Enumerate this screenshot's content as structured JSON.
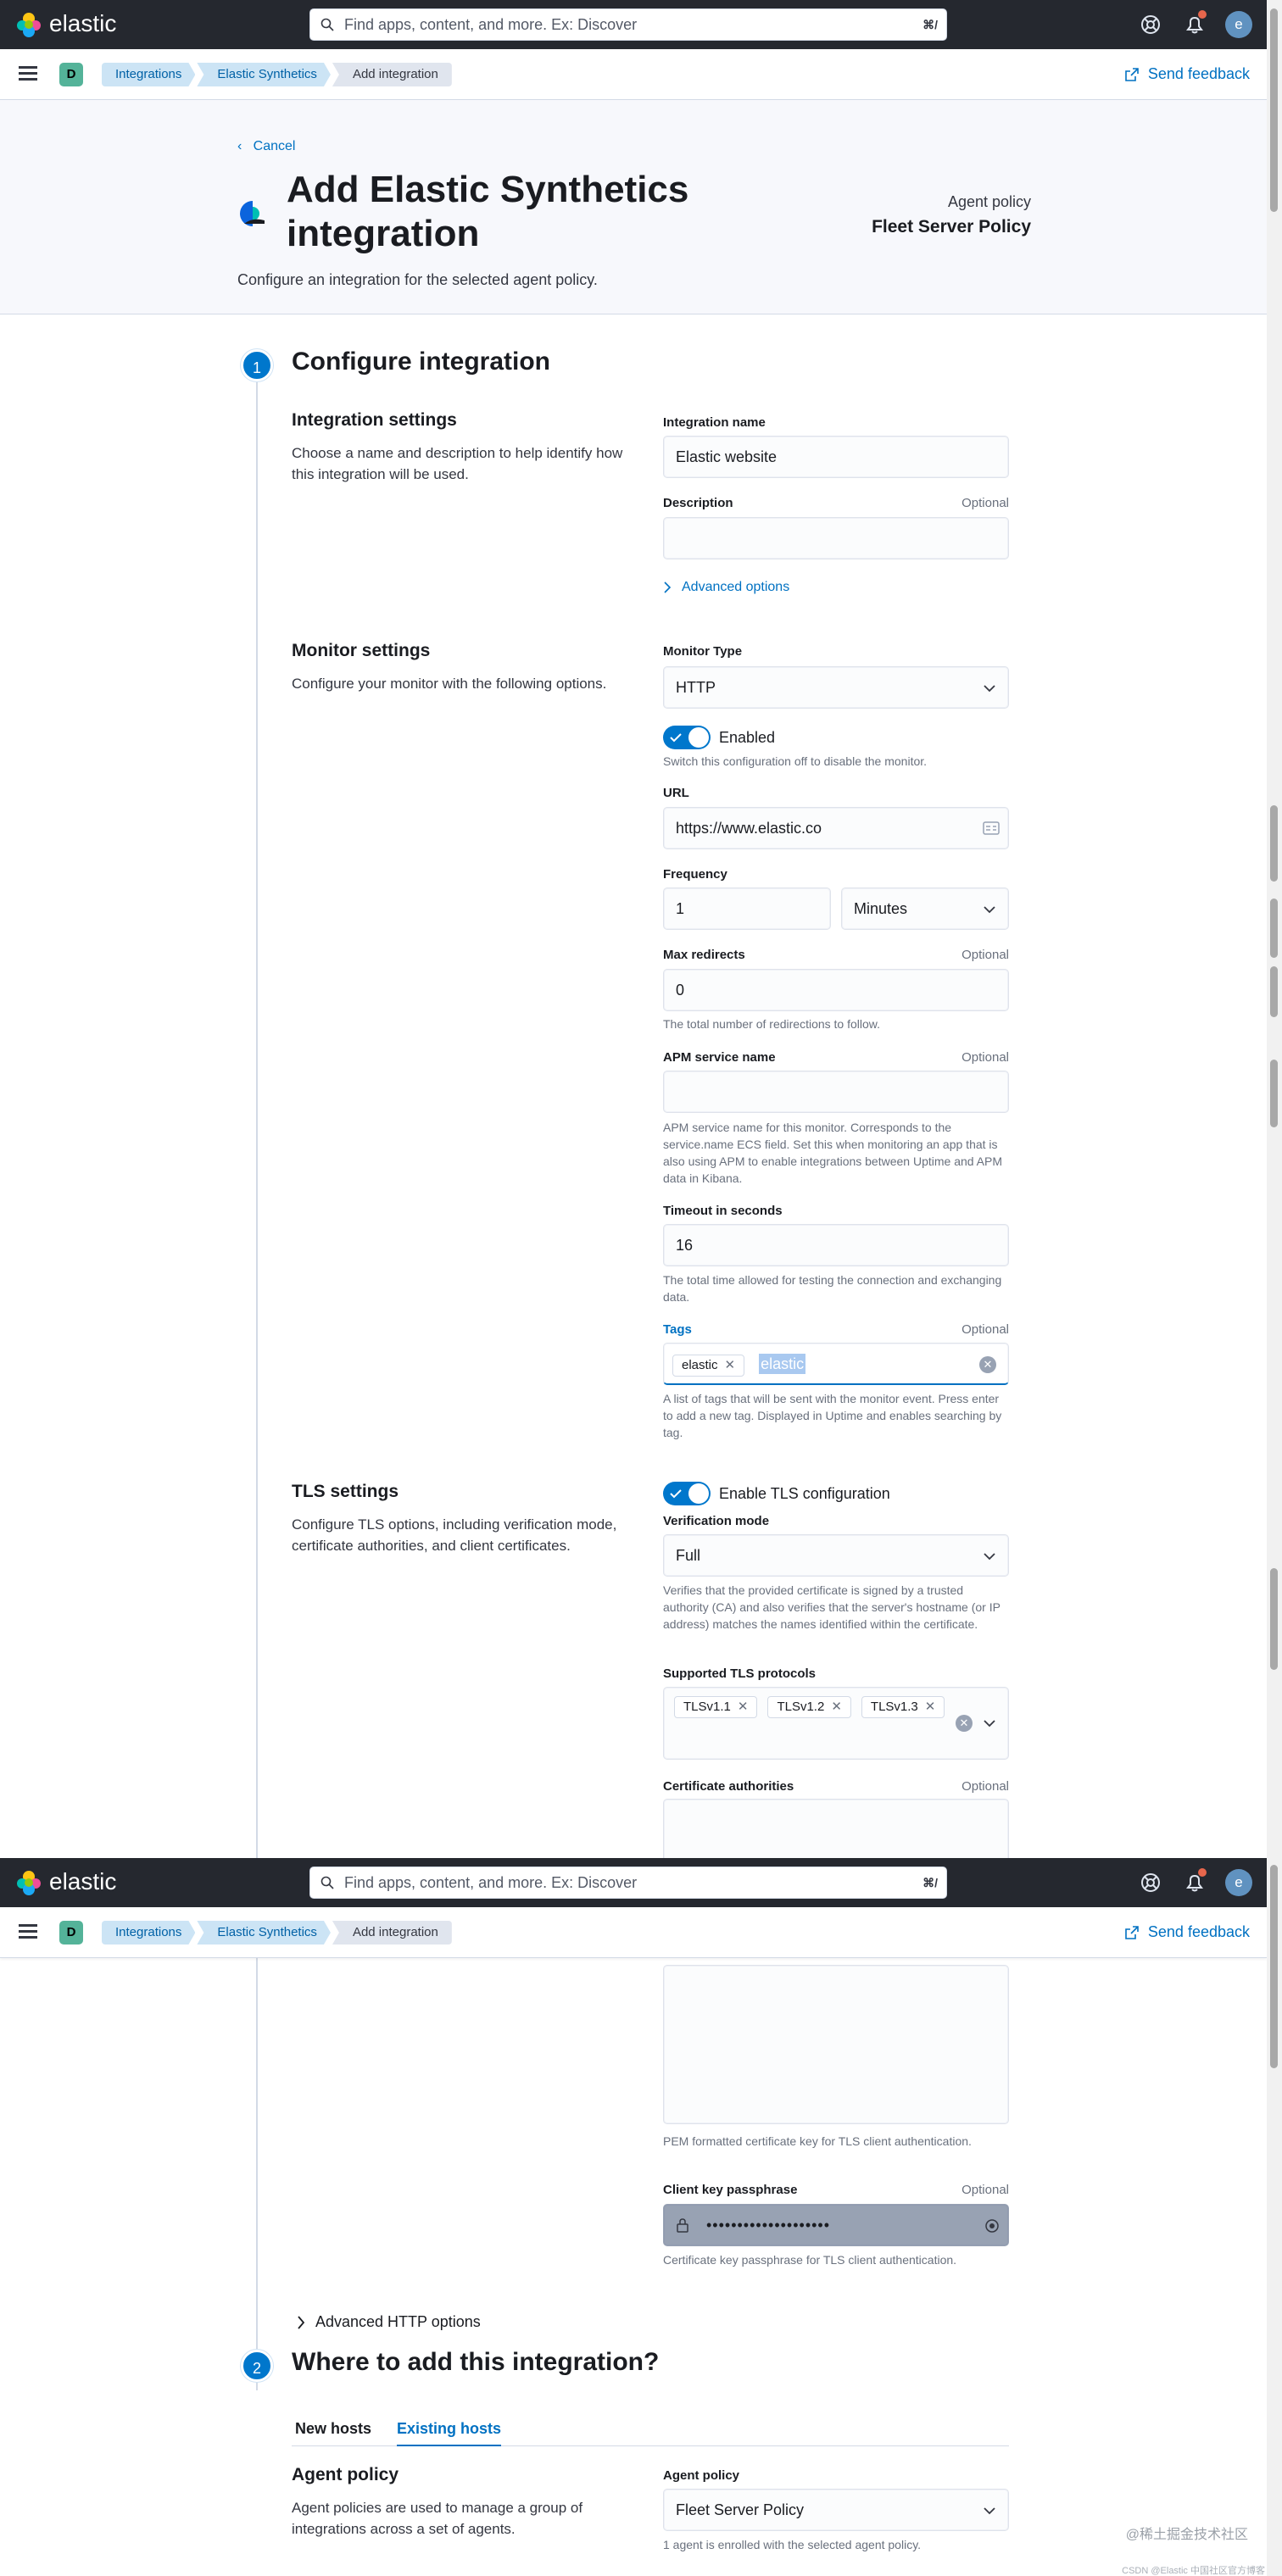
{
  "header": {
    "logo_text": "elastic",
    "search_placeholder": "Find apps, content, and more. Ex: Discover",
    "search_shortcut": "⌘/",
    "avatar_initial": "e"
  },
  "subbar": {
    "space_initial": "D",
    "breadcrumbs": [
      "Integrations",
      "Elastic Synthetics",
      "Add integration"
    ],
    "send_feedback": "Send feedback"
  },
  "page": {
    "cancel": "Cancel",
    "title": "Add Elastic Synthetics integration",
    "subtitle": "Configure an integration for the selected agent policy.",
    "agent_policy_label": "Agent policy",
    "agent_policy_value": "Fleet Server Policy"
  },
  "step1": {
    "number": "1",
    "title": "Configure integration",
    "integration_settings": {
      "title": "Integration settings",
      "description": "Choose a name and description to help identify how this integration will be used.",
      "name_label": "Integration name",
      "name_value": "Elastic website",
      "description_label": "Description",
      "optional": "Optional",
      "advanced": "Advanced options"
    },
    "monitor_settings": {
      "title": "Monitor settings",
      "description": "Configure your monitor with the following options.",
      "monitor_type_label": "Monitor Type",
      "monitor_type_value": "HTTP",
      "enabled_label": "Enabled",
      "enabled_help": "Switch this configuration off to disable the monitor.",
      "url_label": "URL",
      "url_value": "https://www.elastic.co",
      "frequency_label": "Frequency",
      "frequency_value": "1",
      "frequency_unit": "Minutes",
      "max_redirects_label": "Max redirects",
      "max_redirects_value": "0",
      "max_redirects_help": "The total number of redirections to follow.",
      "apm_label": "APM service name",
      "apm_help": "APM service name for this monitor. Corresponds to the service.name ECS field. Set this when monitoring an app that is also using APM to enable integrations between Uptime and APM data in Kibana.",
      "timeout_label": "Timeout in seconds",
      "timeout_value": "16",
      "timeout_help": "The total time allowed for testing the connection and exchanging data.",
      "tags_label": "Tags",
      "tags": [
        "elastic"
      ],
      "tags_input": "elastic",
      "tags_help": "A list of tags that will be sent with the monitor event. Press enter to add a new tag. Displayed in Uptime and enables searching by tag."
    },
    "tls_settings": {
      "title": "TLS settings",
      "description": "Configure TLS options, including verification mode, certificate authorities, and client certificates.",
      "enable_label": "Enable TLS configuration",
      "verification_label": "Verification mode",
      "verification_value": "Full",
      "verification_help": "Verifies that the provided certificate is signed by a trusted authority (CA) and also verifies that the server's hostname (or IP address) matches the names identified within the certificate.",
      "protocols_label": "Supported TLS protocols",
      "protocols": [
        "TLSv1.1",
        "TLSv1.2",
        "TLSv1.3"
      ],
      "ca_label": "Certificate authorities",
      "client_key_help": "PEM formatted certificate key for TLS client authentication.",
      "passphrase_label": "Client key passphrase",
      "passphrase_value": "••••••••••••••••••••",
      "passphrase_help": "Certificate key passphrase for TLS client authentication."
    },
    "advanced_http": "Advanced HTTP options"
  },
  "step2": {
    "number": "2",
    "title": "Where to add this integration?",
    "tabs": [
      "New hosts",
      "Existing hosts"
    ],
    "agent_policy_title": "Agent policy",
    "agent_policy_desc": "Agent policies are used to manage a group of integrations across a set of agents.",
    "agent_policy_label": "Agent policy",
    "agent_policy_value": "Fleet Server Policy",
    "agent_policy_help": "1 agent is enrolled with the selected agent policy."
  },
  "watermark": "@稀土掘金技术社区",
  "watermark_small": "CSDN @Elastic 中国社区官方博客",
  "colors": {
    "accent": "#0077cc",
    "header_bg": "#25282f",
    "page_bg": "#f7f8fc"
  }
}
